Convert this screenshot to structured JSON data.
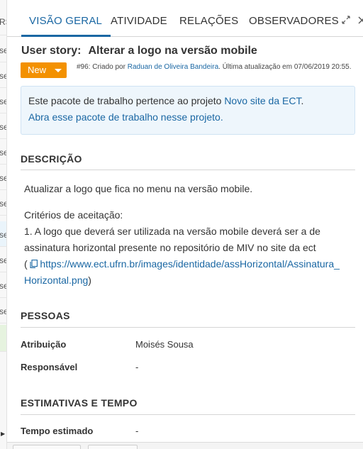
{
  "background_list": {
    "row_texts": [
      "RS",
      "se",
      "se",
      "se",
      "se",
      "se",
      "se",
      "se",
      "se",
      "se",
      "se",
      "se"
    ]
  },
  "tabs": [
    {
      "label": "VISÃO GERAL",
      "active": true
    },
    {
      "label": "ATIVIDADE",
      "active": false
    },
    {
      "label": "RELAÇÕES",
      "active": false
    },
    {
      "label": "OBSERVADORES",
      "active": false
    }
  ],
  "icons": {
    "fullscreen": "expand-icon",
    "close": "close-icon"
  },
  "work_package": {
    "type": "User story:",
    "subject": "Alterar a logo na versão mobile",
    "status": "New",
    "meta_prefix": "#96: Criado por ",
    "author": "Raduan de Oliveira Bandeira",
    "meta_suffix": ". Última atualização em 07/06/2019 20:55."
  },
  "info_box": {
    "line1_text": "Este pacote de trabalho pertence ao projeto ",
    "project_link": "Novo site da ECT",
    "line1_end": ".",
    "line2_link": "Abra esse pacote de trabalho nesse projeto."
  },
  "sections": {
    "description": "DESCRIÇÃO",
    "people": "PESSOAS",
    "estimates": "ESTIMATIVAS E TEMPO"
  },
  "description": {
    "p1": "Atualizar a logo que fica no menu na versão mobile.",
    "p2": "Critérios de aceitação:",
    "p3": "1. A logo que deverá ser utilizada na versão mobile deverá ser a de",
    "p4": "assinatura horizontal presente no repositório de MIV no site da ect",
    "p5_open": "(",
    "link_line1": "https://www.ect.ufrn.br/images/identidade/assHorizontal/Assinatura_",
    "link_line2": "Horizontal.png",
    "p6_close": ")"
  },
  "people": [
    {
      "label": "Atribuição",
      "value": "Moisés Sousa"
    },
    {
      "label": "Responsável",
      "value": "-"
    }
  ],
  "estimates": [
    {
      "label": "Tempo estimado",
      "value": "-"
    }
  ],
  "colors": {
    "accent": "#1a67a3",
    "status_new": "#f39100",
    "info_bg": "#eef6fc"
  }
}
